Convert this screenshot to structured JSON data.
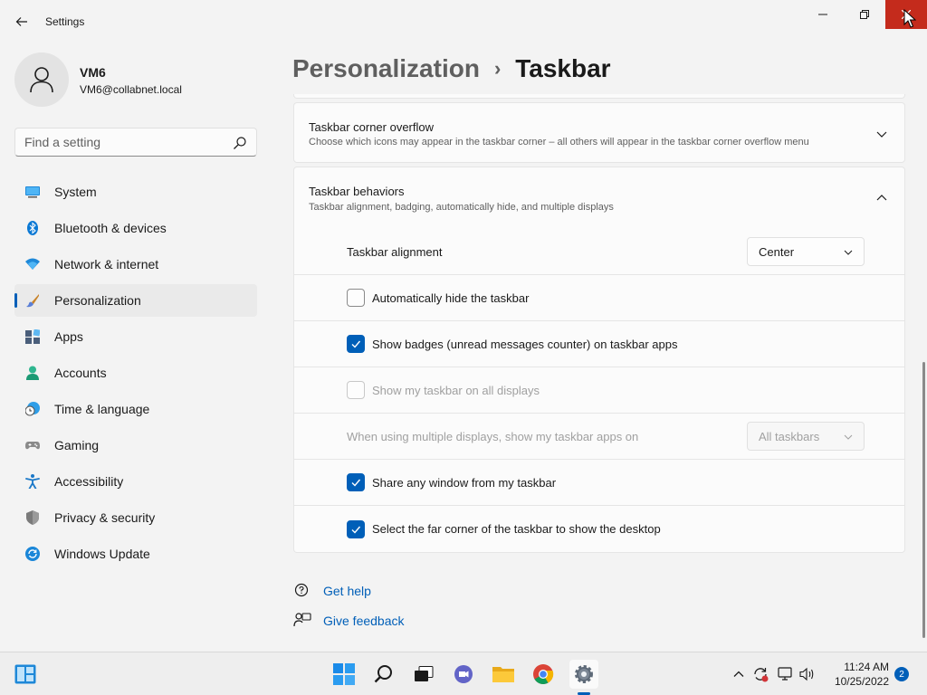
{
  "window": {
    "title": "Settings"
  },
  "user": {
    "name": "VM6",
    "email": "VM6@collabnet.local"
  },
  "search": {
    "placeholder": "Find a setting"
  },
  "sidebar": {
    "items": [
      {
        "label": "System",
        "icon": "system-icon"
      },
      {
        "label": "Bluetooth & devices",
        "icon": "bluetooth-icon"
      },
      {
        "label": "Network & internet",
        "icon": "network-icon"
      },
      {
        "label": "Personalization",
        "icon": "brush-icon",
        "active": true
      },
      {
        "label": "Apps",
        "icon": "apps-icon"
      },
      {
        "label": "Accounts",
        "icon": "accounts-icon"
      },
      {
        "label": "Time & language",
        "icon": "time-language-icon"
      },
      {
        "label": "Gaming",
        "icon": "gaming-icon"
      },
      {
        "label": "Accessibility",
        "icon": "accessibility-icon"
      },
      {
        "label": "Privacy & security",
        "icon": "shield-icon"
      },
      {
        "label": "Windows Update",
        "icon": "windows-update-icon"
      }
    ]
  },
  "breadcrumb": {
    "parent": "Personalization",
    "separator": "›",
    "current": "Taskbar"
  },
  "corner_overflow": {
    "title": "Taskbar corner overflow",
    "description": "Choose which icons may appear in the taskbar corner – all others will appear in the taskbar corner overflow menu"
  },
  "behaviors": {
    "title": "Taskbar behaviors",
    "description": "Taskbar alignment, badging, automatically hide, and multiple displays",
    "alignment_label": "Taskbar alignment",
    "alignment_value": "Center",
    "auto_hide": {
      "label": "Automatically hide the taskbar",
      "checked": false
    },
    "show_badges": {
      "label": "Show badges (unread messages counter) on taskbar apps",
      "checked": true
    },
    "all_displays": {
      "label": "Show my taskbar on all displays",
      "checked": false,
      "disabled": true
    },
    "multi_display_label": "When using multiple displays, show my taskbar apps on",
    "multi_display_value": "All taskbars",
    "share_window": {
      "label": "Share any window from my taskbar",
      "checked": true
    },
    "far_corner": {
      "label": "Select the far corner of the taskbar to show the desktop",
      "checked": true
    }
  },
  "help": {
    "get_help": "Get help",
    "give_feedback": "Give feedback"
  },
  "taskbar": {
    "time": "11:24 AM",
    "date": "10/25/2022",
    "notifications": "2"
  },
  "colors": {
    "accent": "#005fb8",
    "close": "#c42b1c"
  }
}
